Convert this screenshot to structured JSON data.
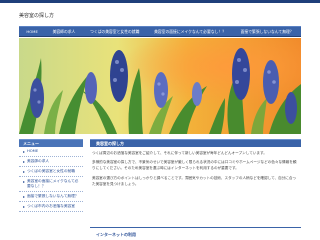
{
  "site": {
    "title": "美容室の探し方"
  },
  "nav": {
    "items": [
      "HOME",
      "美容師の求人",
      "つくばの美容室と女性の就職",
      "美容室の面接にメイクなんて必要なし！？",
      "面接で緊張しないなんて無理？"
    ]
  },
  "sidebar": {
    "heading": "メニュー",
    "items": [
      "HOME",
      "美容師の求人",
      "つくばの美容室と女性の就職",
      "美容室の面接にメイクなんて必要なし！？",
      "面接で緊張しないなんて無理？",
      "つくば市内のお洒落な美容室"
    ]
  },
  "main": {
    "heading": "美容室の探し方",
    "paragraphs": [
      "つくば周辺のお洒落な美容室をご紹介して、それに伴って新しい美容室が毎年どんどんオープンしています。",
      "多様的な美容室の探し方で、不景気のせいで美容室が厳しく限られる状況の中には口コミやホームページなどの色々な情報を頼りにしてください。そのため美容室を選ぶ時にはインターネットを利用するのが重要です。",
      "美容室の選び方のポイントはしっかりと調べることです。雰囲気やカットの技術、スタッフの人柄などを確認して、自分に合った美容室を見つけましょう。"
    ],
    "subheading": "インターネットの利用"
  }
}
